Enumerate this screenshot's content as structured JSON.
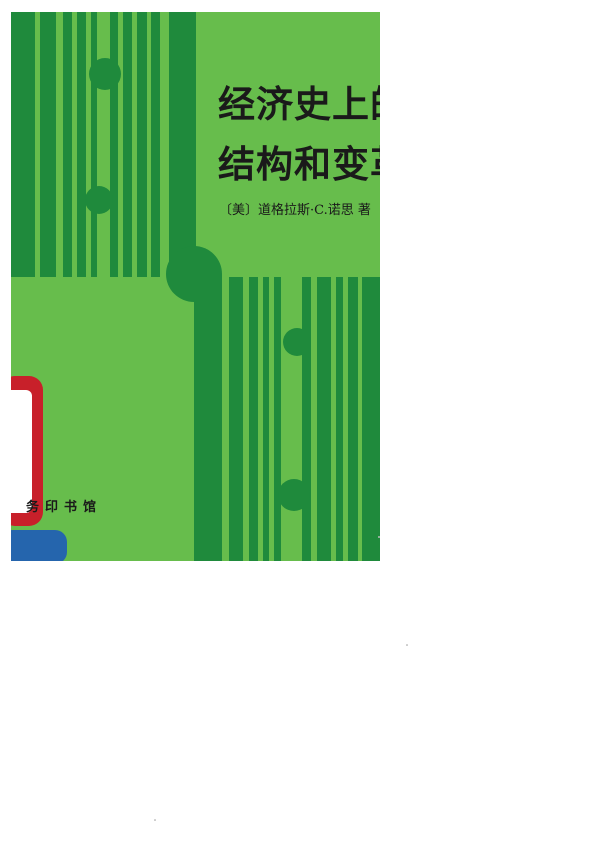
{
  "cover": {
    "title_line_1": "经济史上的",
    "title_line_2": "结构和变革",
    "author": "〔美〕道格拉斯·C.诺思 著",
    "publisher": "务印书馆"
  },
  "colors": {
    "cover_green": "#67bd4c",
    "stripe_dark_green": "#1f8a3c",
    "sticker_red": "#c8202a",
    "sticker_blue": "#2565ad",
    "text_dark": "#1a1a1a"
  }
}
